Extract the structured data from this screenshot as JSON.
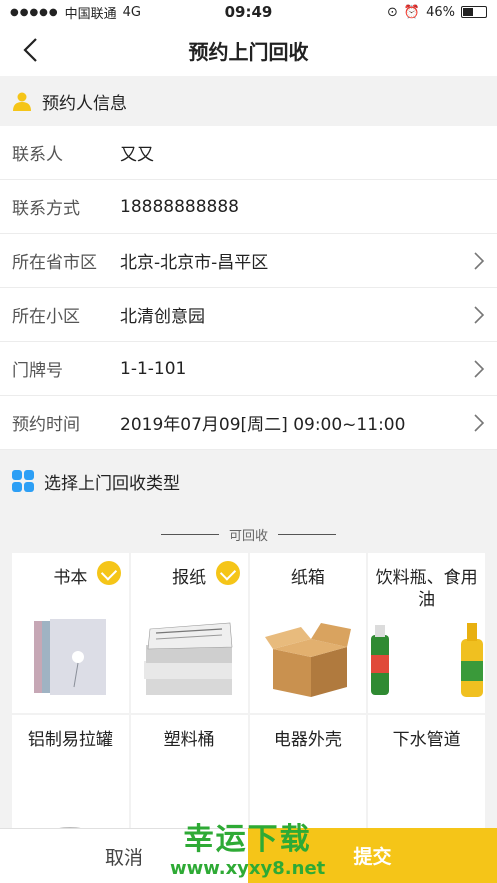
{
  "status_bar": {
    "carrier": "中国联通",
    "network": "4G",
    "time": "09:49",
    "battery": "46%",
    "battery_level": 0.46
  },
  "nav": {
    "title": "预约上门回收"
  },
  "contact_section": {
    "title": "预约人信息"
  },
  "form": [
    {
      "label": "联系人",
      "value": "又又",
      "has_chevron": false
    },
    {
      "label": "联系方式",
      "value": "18888888888",
      "has_chevron": false
    },
    {
      "label": "所在省市区",
      "value": "北京-北京市-昌平区",
      "has_chevron": true
    },
    {
      "label": "所在小区",
      "value": "北清创意园",
      "has_chevron": true
    },
    {
      "label": "门牌号",
      "value": "1-1-101",
      "has_chevron": true
    },
    {
      "label": "预约时间",
      "value": "2019年07月09[周二] 09:00~11:00",
      "has_chevron": true
    }
  ],
  "type_section": {
    "title": "选择上门回收类型"
  },
  "recyclable_label": "可回收",
  "items": [
    {
      "label": "书本",
      "selected": true,
      "icon": "book-icon"
    },
    {
      "label": "报纸",
      "selected": true,
      "icon": "newspaper-icon"
    },
    {
      "label": "纸箱",
      "selected": false,
      "icon": "cardboard-box-icon"
    },
    {
      "label": "饮料瓶、食用油",
      "selected": false,
      "icon": "bottles-icon"
    },
    {
      "label": "铝制易拉罐",
      "selected": false,
      "icon": "can-icon"
    },
    {
      "label": "塑料桶",
      "selected": false,
      "icon": "bucket-icon"
    },
    {
      "label": "电器外壳",
      "selected": false,
      "icon": "appliance-shell-icon"
    },
    {
      "label": "下水管道",
      "selected": false,
      "icon": "pipe-icon"
    }
  ],
  "buttons": {
    "cancel": "取消",
    "submit": "提交"
  },
  "watermark": {
    "line1": "幸运下载",
    "line2": "www.xyxy8.net"
  },
  "colors": {
    "accent": "#f5c518",
    "watermark": "#2eaa35",
    "grid_icon": "#2d9ff5"
  }
}
